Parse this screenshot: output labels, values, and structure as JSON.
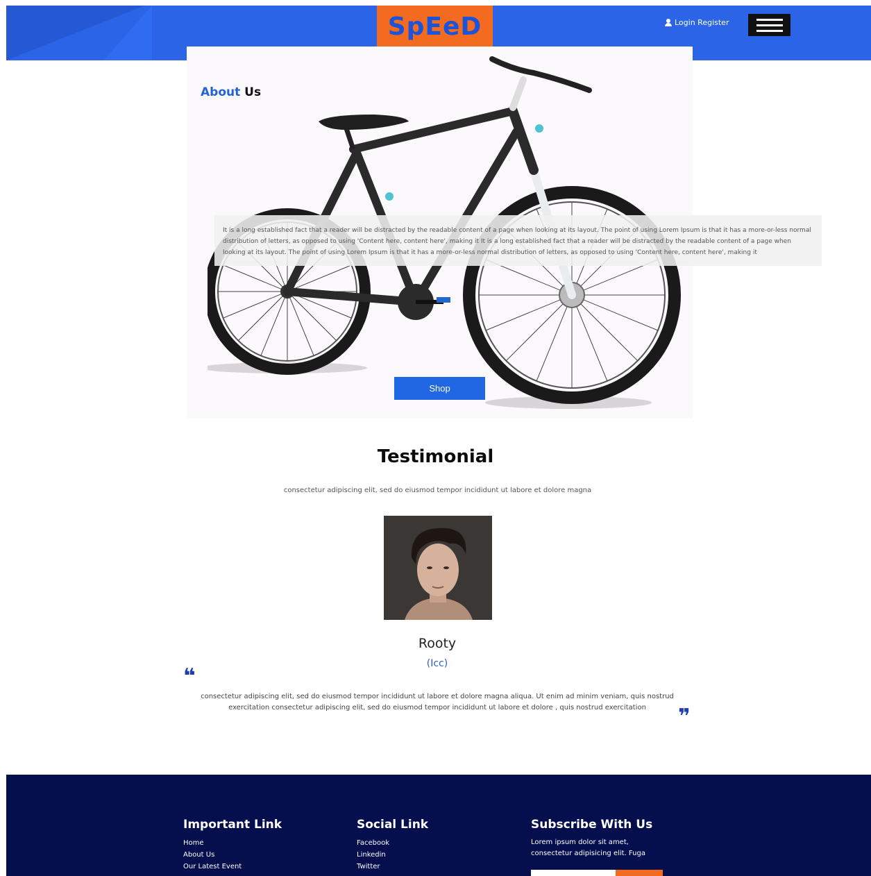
{
  "header": {
    "logo": "SpEeD",
    "login_label": "Login Register",
    "user_icon": "user-icon",
    "menu_icon": "hamburger-icon",
    "colors": {
      "header_bg": "#2b64e6",
      "logo_bg": "#f26b21",
      "logo_text": "#1b54d9"
    }
  },
  "about": {
    "title_highlight": "About",
    "title_rest": "Us",
    "body": "It is a long established fact that a reader will be distracted by the readable content of a page when looking at its layout. The point of using Lorem Ipsum is that it has a more-or-less normal distribution of letters, as opposed to using 'Content here, content here', making it It is a long established fact that a reader will be distracted by the readable content of a page when looking at its layout. The point of using Lorem Ipsum is that it has a more-or-less normal distribution of letters, as opposed to using 'Content here, content here', making it",
    "shop_label": "Shop"
  },
  "testimonial": {
    "title": "Testimonial",
    "subtitle": "consectetur adipiscing elit, sed do eiusmod tempor incididunt ut labore et dolore magna",
    "name": "Rooty",
    "role": "(Icc)",
    "quote_open": "❝",
    "quote_close": "❞",
    "body": "consectetur adipiscing elit, sed do eiusmod tempor incididunt ut labore et dolore magna aliqua. Ut enim ad minim veniam, quis nostrud exercitation consectetur adipiscing elit, sed do eiusmod tempor incididunt ut labore et dolore , quis nostrud exercitation"
  },
  "footer": {
    "important": {
      "title": "Important Link",
      "links": [
        "Home",
        "About Us",
        "Our Latest Event"
      ]
    },
    "social": {
      "title": "Social Link",
      "links": [
        "Facebook",
        "Linkedin",
        "Twitter"
      ]
    },
    "subscribe": {
      "title": "Subscribe With Us",
      "text": "Lorem ipsum dolor sit amet, consectetur adipisicing elit. Fuga"
    },
    "colors": {
      "footer_bg": "#060f4e",
      "accent": "#f26b21"
    }
  }
}
